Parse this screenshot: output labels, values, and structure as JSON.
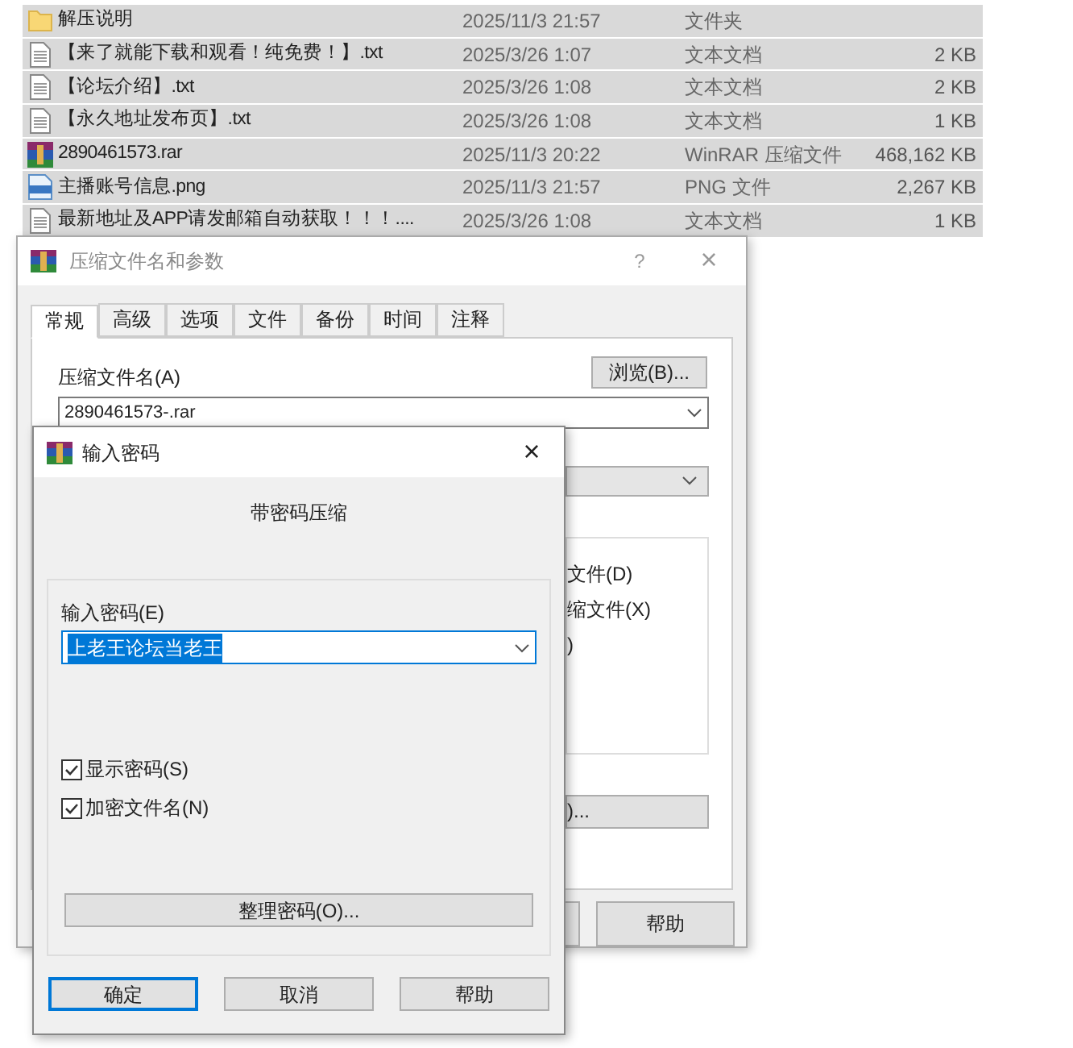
{
  "files": [
    {
      "name": "解压说明",
      "date": "2025/11/3 21:57",
      "type": "文件夹",
      "kind": "folder",
      "selected": true
    },
    {
      "name": "【来了就能下载和观看！纯免费！】.txt",
      "date": "2025/3/26 1:07",
      "type": "文本文档",
      "size": "2 KB",
      "kind": "text",
      "selected": true
    },
    {
      "name": "【论坛介绍】.txt",
      "date": "2025/3/26 1:08",
      "type": "文本文档",
      "size": "2 KB",
      "kind": "text",
      "selected": true
    },
    {
      "name": "【永久地址发布页】.txt",
      "date": "2025/3/26 1:08",
      "type": "文本文档",
      "size": "1 KB",
      "kind": "text",
      "selected": true
    },
    {
      "name": "2890461573.rar",
      "date": "2025/11/3 20:22",
      "type": "WinRAR 压缩文件",
      "size": "468,162 KB",
      "kind": "archive",
      "selected": true
    },
    {
      "name": "主播账号信息.png",
      "date": "2025/11/3 21:57",
      "type": "PNG 文件",
      "size": "2,267 KB",
      "kind": "image",
      "selected": true
    },
    {
      "name": "最新地址及APP请发邮箱自动获取！！！....",
      "date": "2025/3/26 1:08",
      "type": "文本文档",
      "size": "1 KB",
      "kind": "text",
      "selected": true
    }
  ],
  "archive_dialog": {
    "title": "压缩文件名和参数",
    "help": "?",
    "close": "×",
    "tabs": [
      {
        "label": "常规",
        "selected": true
      },
      {
        "label": "高级",
        "selected": false
      },
      {
        "label": "选项",
        "selected": false
      },
      {
        "label": "文件",
        "selected": false
      },
      {
        "label": "备份",
        "selected": false
      },
      {
        "label": "时间",
        "selected": false
      },
      {
        "label": "注释",
        "selected": false
      }
    ],
    "name_label": "压缩文件名(A)",
    "browse": "浏览(B)...",
    "name_value": "2890461573-.rar",
    "list_items": [
      "文件(D)",
      "缩文件(X)",
      ")"
    ],
    "partial_button": ")...",
    "help_button": "帮助"
  },
  "password_dialog": {
    "title": "输入密码",
    "close": "×",
    "heading": "带密码压缩",
    "label": "输入密码(E)",
    "value": "上老王论坛当老王",
    "options": [
      {
        "label": "显示密码(S)",
        "checked": true
      },
      {
        "label": "加密文件名(N)",
        "checked": true
      }
    ],
    "organize": "整理密码(O)...",
    "buttons": [
      {
        "label": "确定",
        "selected": true
      },
      {
        "label": "取消",
        "selected": false
      },
      {
        "label": "帮助",
        "selected": false
      }
    ]
  }
}
